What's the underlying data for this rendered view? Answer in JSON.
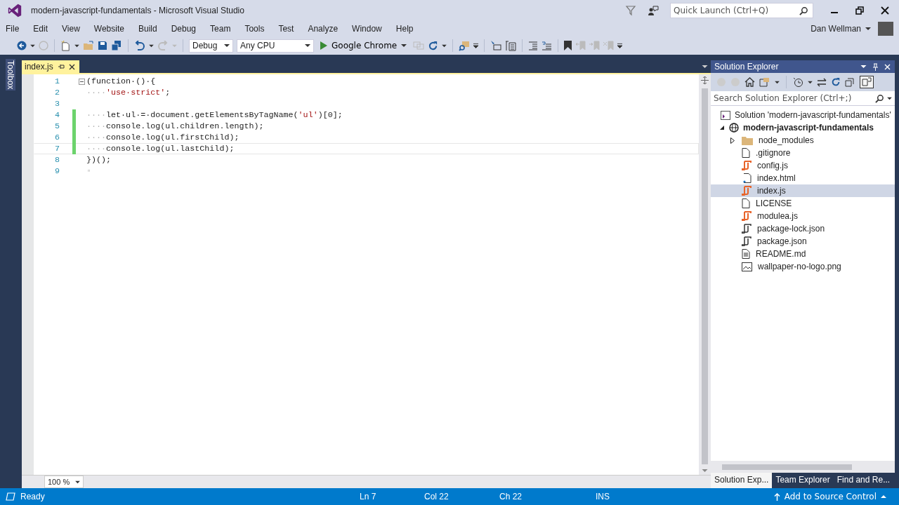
{
  "window": {
    "title": "modern-javascript-fundamentals - Microsoft Visual Studio"
  },
  "quick_launch": {
    "placeholder": "Quick Launch (Ctrl+Q)"
  },
  "menu": [
    "File",
    "Edit",
    "View",
    "Website",
    "Build",
    "Debug",
    "Team",
    "Tools",
    "Test",
    "Analyze",
    "Window",
    "Help"
  ],
  "user": {
    "name": "Dan Wellman"
  },
  "toolbar": {
    "configuration": "Debug",
    "platform": "Any CPU",
    "run_target": "Google Chrome"
  },
  "toolbox": {
    "label": "Toolbox"
  },
  "editor_tabs": [
    {
      "label": "index.js",
      "selected": true
    }
  ],
  "code_lines": [
    {
      "number": "1",
      "changed": false,
      "current": false,
      "fold": true,
      "tokens": [
        {
          "kind": "plain",
          "text": "(function·()·{"
        }
      ]
    },
    {
      "number": "2",
      "changed": false,
      "current": false,
      "fold": false,
      "tokens": [
        {
          "kind": "space",
          "text": "····"
        },
        {
          "kind": "string",
          "text": "'use·strict'"
        },
        {
          "kind": "plain",
          "text": ";"
        }
      ]
    },
    {
      "number": "3",
      "changed": false,
      "current": false,
      "fold": false
    },
    {
      "number": "4",
      "changed": true,
      "current": false,
      "fold": false,
      "tokens": [
        {
          "kind": "space",
          "text": "····"
        },
        {
          "kind": "plain",
          "text": "let·ul·=·document.getElementsByTagName("
        },
        {
          "kind": "string",
          "text": "'ul'"
        },
        {
          "kind": "plain",
          "text": ")[0];"
        }
      ]
    },
    {
      "number": "5",
      "changed": true,
      "current": false,
      "fold": false,
      "tokens": [
        {
          "kind": "space",
          "text": "····"
        },
        {
          "kind": "plain",
          "text": "console.log(ul.children.length);"
        }
      ]
    },
    {
      "number": "6",
      "changed": true,
      "current": false,
      "fold": false,
      "tokens": [
        {
          "kind": "space",
          "text": "····"
        },
        {
          "kind": "plain",
          "text": "console.log(ul.firstChild);"
        }
      ]
    },
    {
      "number": "7",
      "changed": true,
      "current": true,
      "fold": false,
      "tokens": [
        {
          "kind": "space",
          "text": "····"
        },
        {
          "kind": "plain",
          "text": "console.log(ul.lastChild);"
        }
      ]
    },
    {
      "number": "8",
      "changed": false,
      "current": false,
      "fold": false,
      "tokens": [
        {
          "kind": "plain",
          "text": "})();"
        }
      ]
    },
    {
      "number": "9",
      "changed": false,
      "current": false,
      "fold": false,
      "tokens": [
        {
          "kind": "space",
          "text": "▫"
        }
      ]
    }
  ],
  "zoom": {
    "value": "100 %"
  },
  "solution_explorer": {
    "title": "Solution Explorer",
    "search": {
      "placeholder": "Search Solution Explorer (Ctrl+;)"
    },
    "solution": "Solution 'modern-javascript-fundamentals'",
    "project": {
      "name": "modern-javascript-fundamentals",
      "expanded": true,
      "children": [
        {
          "name": "node_modules",
          "kind": "folder",
          "selected": false
        },
        {
          "name": ".gitignore",
          "kind": "file",
          "selected": false
        },
        {
          "name": "config.js",
          "kind": "js",
          "selected": false
        },
        {
          "name": "index.html",
          "kind": "html",
          "selected": false
        },
        {
          "name": "index.js",
          "kind": "js",
          "selected": true
        },
        {
          "name": "LICENSE",
          "kind": "file",
          "selected": false
        },
        {
          "name": "modulea.js",
          "kind": "js",
          "selected": false
        },
        {
          "name": "package-lock.json",
          "kind": "json",
          "selected": false
        },
        {
          "name": "package.json",
          "kind": "json",
          "selected": false
        },
        {
          "name": "README.md",
          "kind": "text",
          "selected": false
        },
        {
          "name": "wallpaper-no-logo.png",
          "kind": "image",
          "selected": false
        }
      ]
    },
    "tabs": [
      {
        "label": "Solution Exp...",
        "selected": true
      },
      {
        "label": "Team Explorer",
        "selected": false
      },
      {
        "label": "Find and Re...",
        "selected": false
      }
    ]
  },
  "status_bar": {
    "state": "Ready",
    "line": "Ln 7",
    "column": "Col 22",
    "char": "Ch 22",
    "mode": "INS",
    "source_control": "Add to Source Control"
  }
}
